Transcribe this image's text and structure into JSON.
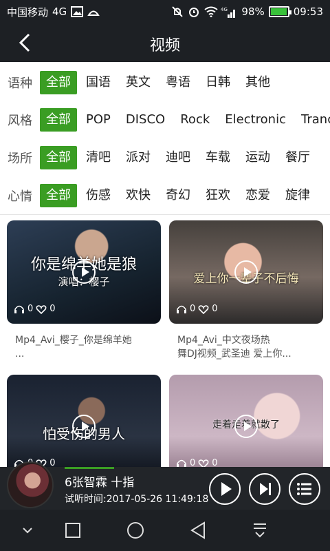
{
  "status_bar": {
    "carrier": "中国移动",
    "network": "4G",
    "signal_label": "4G",
    "battery": "98%",
    "time": "09:53"
  },
  "header": {
    "title": "视频"
  },
  "filters": [
    {
      "name": "语种",
      "options": [
        "全部",
        "国语",
        "英文",
        "粤语",
        "日韩",
        "其他"
      ],
      "selected": "全部"
    },
    {
      "name": "风格",
      "options": [
        "全部",
        "POP",
        "DISCO",
        "Rock",
        "Electronic",
        "Tranc"
      ],
      "selected": "全部"
    },
    {
      "name": "场所",
      "options": [
        "全部",
        "清吧",
        "派对",
        "迪吧",
        "车载",
        "运动",
        "餐厅"
      ],
      "selected": "全部"
    },
    {
      "name": "心情",
      "options": [
        "全部",
        "伤感",
        "欢快",
        "奇幻",
        "狂欢",
        "恋爱",
        "旋律"
      ],
      "selected": "全部"
    }
  ],
  "videos": [
    {
      "overlay": "你是绵羊她是狼",
      "overlay2": "演唱：樱子",
      "listens": "0",
      "likes": "0",
      "caption_line1": "Mp4_Avi_樱子_你是绵羊她",
      "caption_line2": "..."
    },
    {
      "overlay": "爱上你一辈子不后悔",
      "overlay2": "",
      "listens": "0",
      "likes": "0",
      "caption_line1": "Mp4_Avi_中文夜场热",
      "caption_line2": "舞DJ视频_武圣迪 爱上你..."
    },
    {
      "overlay": "怕受伤的男人",
      "overlay2": "",
      "listens": "0",
      "likes": "0",
      "caption_line1": "",
      "caption_line2": ""
    },
    {
      "overlay": "走着走着就散了",
      "overlay2": "",
      "listens": "0",
      "likes": "0",
      "caption_line1": "",
      "caption_line2": ""
    }
  ],
  "player": {
    "title": "6张智霖 十指",
    "trial_time": "试听时间:2017-05-26 11:49:18",
    "progress_fraction": 0.15
  },
  "colors": {
    "accent": "#3a9d23",
    "bar": "#1d2024"
  }
}
